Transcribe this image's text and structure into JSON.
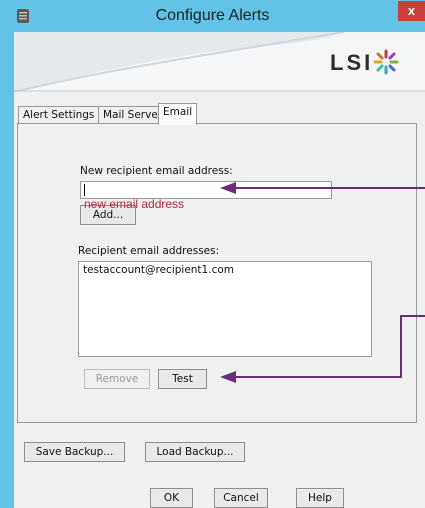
{
  "window": {
    "title": "Configure Alerts",
    "close_label": "x",
    "icon": "app-db-icon"
  },
  "banner": {
    "logo_text": "LSI",
    "logo_icon": "lsi-star-icon"
  },
  "tabs": [
    {
      "label": "Alert Settings",
      "active": false
    },
    {
      "label": "Mail Server",
      "active": false
    },
    {
      "label": "Email",
      "active": true
    }
  ],
  "email_tab": {
    "new_recipient_label": "New recipient email address:",
    "new_recipient_value": "",
    "annotation": "new email address",
    "add_button": "Add...",
    "recipients_label": "Recipient email addresses:",
    "recipients": [
      "testaccount@recipient1.com"
    ],
    "remove_button": "Remove",
    "test_button": "Test"
  },
  "backup": {
    "save_button": "Save Backup...",
    "load_button": "Load Backup..."
  },
  "footer": {
    "ok_button": "OK",
    "cancel_button": "Cancel",
    "help_button": "Help"
  },
  "colors": {
    "titlebar": "#62c3e6",
    "close": "#c9413a",
    "annotation": "#b3283b",
    "arrow": "#6b2d7b"
  }
}
